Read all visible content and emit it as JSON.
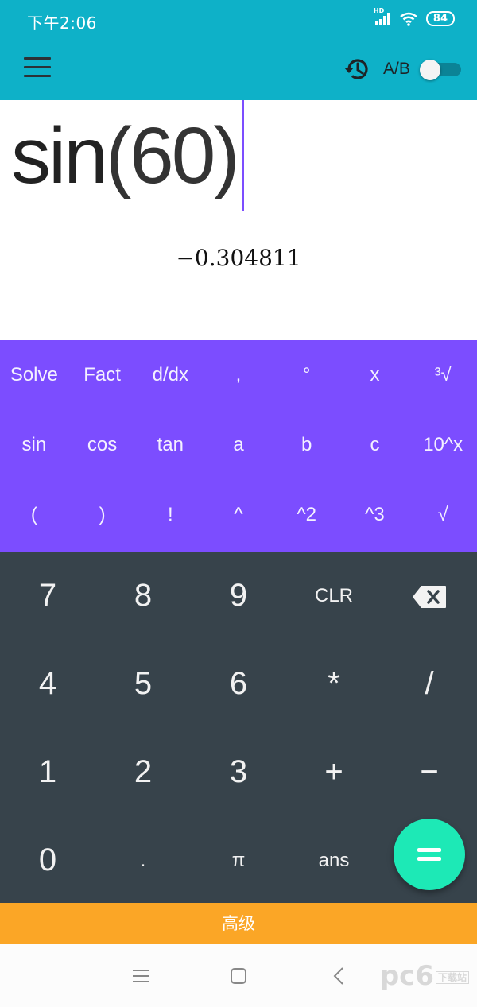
{
  "status": {
    "time": "下午2:06",
    "battery": "84",
    "network": "HD"
  },
  "toolbar": {
    "ab_label": "A/B",
    "colors": {
      "bar": "#0eb1c8"
    }
  },
  "display": {
    "expression_fn": "sin",
    "expression_open": "(",
    "expression_arg": "60",
    "expression_close": ")",
    "result": "−0.304811"
  },
  "function_keys": {
    "rows": [
      [
        "Solve",
        "Fact",
        "d/dx",
        ",",
        "°",
        "x",
        "³√"
      ],
      [
        "sin",
        "cos",
        "tan",
        "a",
        "b",
        "c",
        "10^x"
      ],
      [
        "(",
        ")",
        "!",
        "^",
        "^2",
        "^3",
        "√"
      ]
    ]
  },
  "number_keys": {
    "rows": [
      [
        "7",
        "8",
        "9",
        "CLR",
        "backspace-icon"
      ],
      [
        "4",
        "5",
        "6",
        "*",
        "/"
      ],
      [
        "1",
        "2",
        "3",
        "+",
        "−"
      ],
      [
        "0",
        ".",
        "π",
        "ans",
        ""
      ]
    ]
  },
  "advanced_label": "高级",
  "watermark": {
    "text": "pc6",
    "sub": "下载站"
  }
}
